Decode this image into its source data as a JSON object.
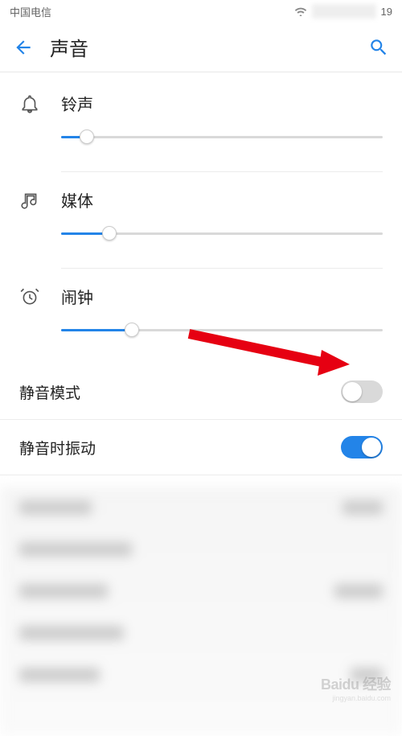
{
  "status": {
    "carrier": "中国电信",
    "time_fragment": "19"
  },
  "header": {
    "title": "声音"
  },
  "volumes": {
    "ringtone": {
      "label": "铃声",
      "percent": 8
    },
    "media": {
      "label": "媒体",
      "percent": 15
    },
    "alarm": {
      "label": "闹钟",
      "percent": 22
    }
  },
  "toggles": {
    "silent_mode": {
      "label": "静音模式",
      "on": false
    },
    "vibrate_on_silent": {
      "label": "静音时振动",
      "on": true
    }
  },
  "watermark": {
    "brand": "Baidu 经验",
    "url": "jingyan.baidu.com"
  },
  "icons": {
    "wifi": "wifi-icon"
  },
  "colors": {
    "accent": "#2384e8",
    "arrow": "#e60012"
  }
}
